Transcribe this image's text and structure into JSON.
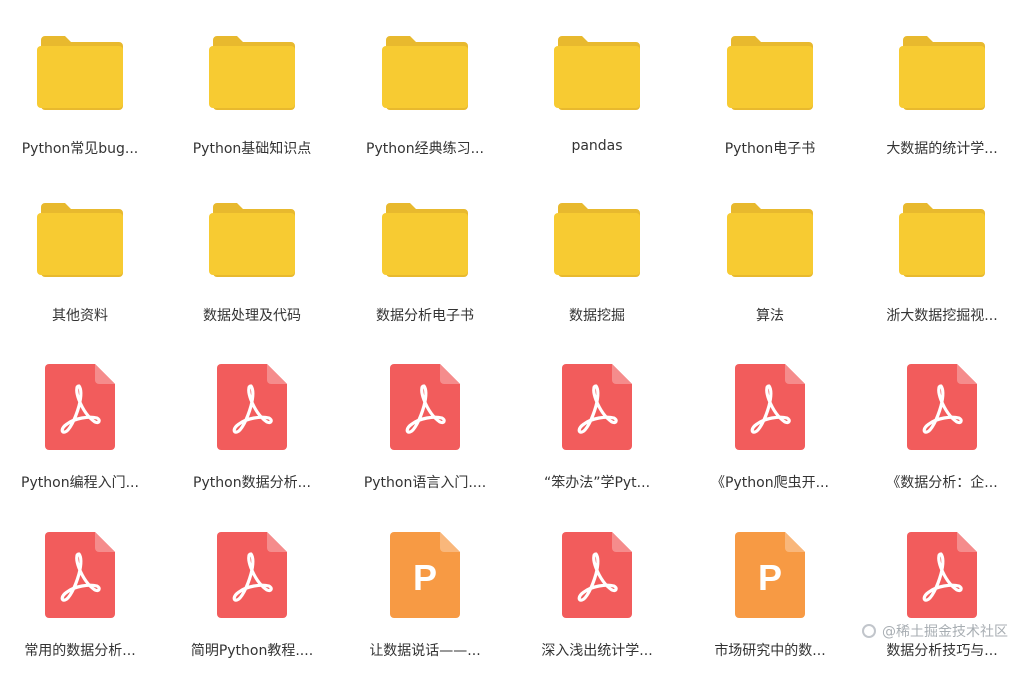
{
  "colors": {
    "folder_back": "#E8B92E",
    "folder_front": "#F7CB32",
    "pdf": "#F25C5C",
    "pdf_fold": "#F58C8C",
    "ppt": "#F79A44",
    "ppt_fold": "#F9B77B",
    "label": "#333333"
  },
  "files": [
    {
      "type": "folder",
      "name": "Python常见bug...",
      "icon": "folder-icon"
    },
    {
      "type": "folder",
      "name": "Python基础知识点",
      "icon": "folder-icon"
    },
    {
      "type": "folder",
      "name": "Python经典练习...",
      "icon": "folder-icon"
    },
    {
      "type": "folder",
      "name": "pandas",
      "icon": "folder-icon"
    },
    {
      "type": "folder",
      "name": "Python电子书",
      "icon": "folder-icon"
    },
    {
      "type": "folder",
      "name": "大数据的统计学...",
      "icon": "folder-icon"
    },
    {
      "type": "folder",
      "name": "其他资料",
      "icon": "folder-icon"
    },
    {
      "type": "folder",
      "name": "数据处理及代码",
      "icon": "folder-icon"
    },
    {
      "type": "folder",
      "name": "数据分析电子书",
      "icon": "folder-icon"
    },
    {
      "type": "folder",
      "name": "数据挖掘",
      "icon": "folder-icon"
    },
    {
      "type": "folder",
      "name": "算法",
      "icon": "folder-icon"
    },
    {
      "type": "folder",
      "name": "浙大数据挖掘视...",
      "icon": "folder-icon"
    },
    {
      "type": "pdf",
      "name": "Python编程入门...",
      "icon": "pdf-icon"
    },
    {
      "type": "pdf",
      "name": "Python数据分析...",
      "icon": "pdf-icon"
    },
    {
      "type": "pdf",
      "name": "Python语言入门....",
      "icon": "pdf-icon"
    },
    {
      "type": "pdf",
      "name": "“笨办法”学Pyt...",
      "icon": "pdf-icon"
    },
    {
      "type": "pdf",
      "name": "《Python爬虫开...",
      "icon": "pdf-icon"
    },
    {
      "type": "pdf",
      "name": "《数据分析：企...",
      "icon": "pdf-icon"
    },
    {
      "type": "pdf",
      "name": "常用的数据分析...",
      "icon": "pdf-icon"
    },
    {
      "type": "pdf",
      "name": "简明Python教程....",
      "icon": "pdf-icon"
    },
    {
      "type": "ppt",
      "name": "让数据说话——...",
      "icon": "ppt-icon",
      "letter": "P"
    },
    {
      "type": "pdf",
      "name": "深入浅出统计学...",
      "icon": "pdf-icon"
    },
    {
      "type": "ppt",
      "name": "市场研究中的数...",
      "icon": "ppt-icon",
      "letter": "P"
    },
    {
      "type": "pdf",
      "name": "数据分析技巧与...",
      "icon": "pdf-icon"
    }
  ],
  "watermark": {
    "text": "@稀土掘金技术社区",
    "icon": "platform-logo-icon"
  }
}
